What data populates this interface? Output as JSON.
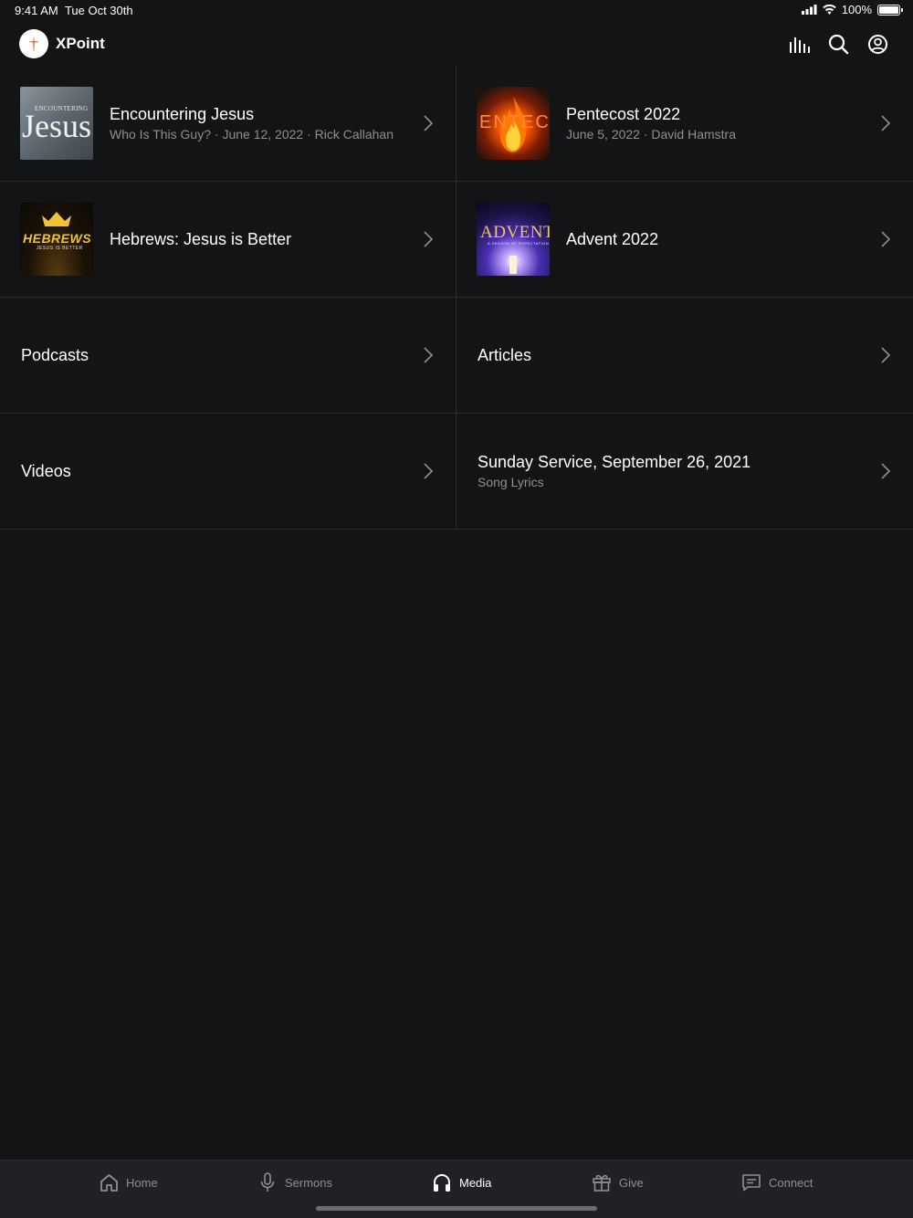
{
  "status_bar": {
    "time": "9:41 AM",
    "date": "Tue Oct 30th",
    "battery": "100%",
    "battery_level": 1.0
  },
  "header": {
    "app_title": "XPoint",
    "icons": [
      "audio-bars-icon",
      "search-icon",
      "account-icon"
    ]
  },
  "items": [
    {
      "title": "Encountering Jesus",
      "subtitle": "Who Is This Guy? · June 12, 2022 · Rick Callahan",
      "thumb_text_1": "ENCOUNTERING",
      "thumb_text_2": "Jesus"
    },
    {
      "title": "Pentecost 2022",
      "subtitle": "June 5, 2022 · David Hamstra",
      "thumb_text_1": "ENTECOS"
    },
    {
      "title": "Hebrews: Jesus is Better",
      "thumb_text_1": "HEBREWS",
      "thumb_text_2": "JESUS IS BETTER"
    },
    {
      "title": "Advent 2022",
      "thumb_text_1": "ADVENT",
      "thumb_text_2": "A SEASON OF EXPECTATION"
    },
    {
      "title": "Podcasts"
    },
    {
      "title": "Articles"
    },
    {
      "title": "Videos"
    },
    {
      "title": "Sunday Service, September 26, 2021",
      "subtitle": "Song Lyrics"
    }
  ],
  "tabs": [
    {
      "label": "Home",
      "icon": "home-icon",
      "active": false
    },
    {
      "label": "Sermons",
      "icon": "microphone-icon",
      "active": false
    },
    {
      "label": "Media",
      "icon": "headphones-icon",
      "active": true
    },
    {
      "label": "Give",
      "icon": "gift-icon",
      "active": false
    },
    {
      "label": "Connect",
      "icon": "message-icon",
      "active": false
    }
  ],
  "colors": {
    "background": "#131416",
    "tab_bar": "#202124",
    "divider": "#2a2b2e",
    "secondary_text": "#8e8f93",
    "logo_accent": "#e8742c"
  }
}
